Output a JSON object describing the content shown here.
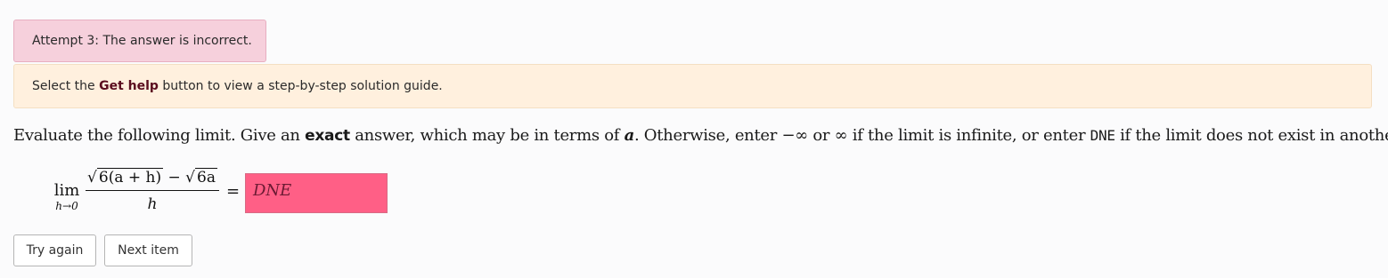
{
  "feedback": {
    "error_text": "Attempt 3: The answer is incorrect.",
    "help_prefix": "Select the ",
    "help_bold": "Get help",
    "help_suffix": " button to view a step-by-step solution guide."
  },
  "question": {
    "part1": "Evaluate the following limit. Give an ",
    "exact": "exact",
    "part2": " answer, which may be in terms of ",
    "var": "a",
    "part3": ". Otherwise, enter −∞ or ∞ if the limit is infinite, or enter ",
    "dne": "DNE",
    "part4": " if the limit does not exist in another way."
  },
  "math": {
    "lim": "lim",
    "lim_sub": "h→0",
    "radical1_sign": "√",
    "radical1_body": "6(a + h)",
    "minus": " − ",
    "radical2_sign": "√",
    "radical2_body": "6a",
    "denominator": "h",
    "equals": "="
  },
  "answer": {
    "value": "DNE",
    "status_color": "#ff5f86"
  },
  "buttons": {
    "try_again": "Try again",
    "next_item": "Next item"
  }
}
